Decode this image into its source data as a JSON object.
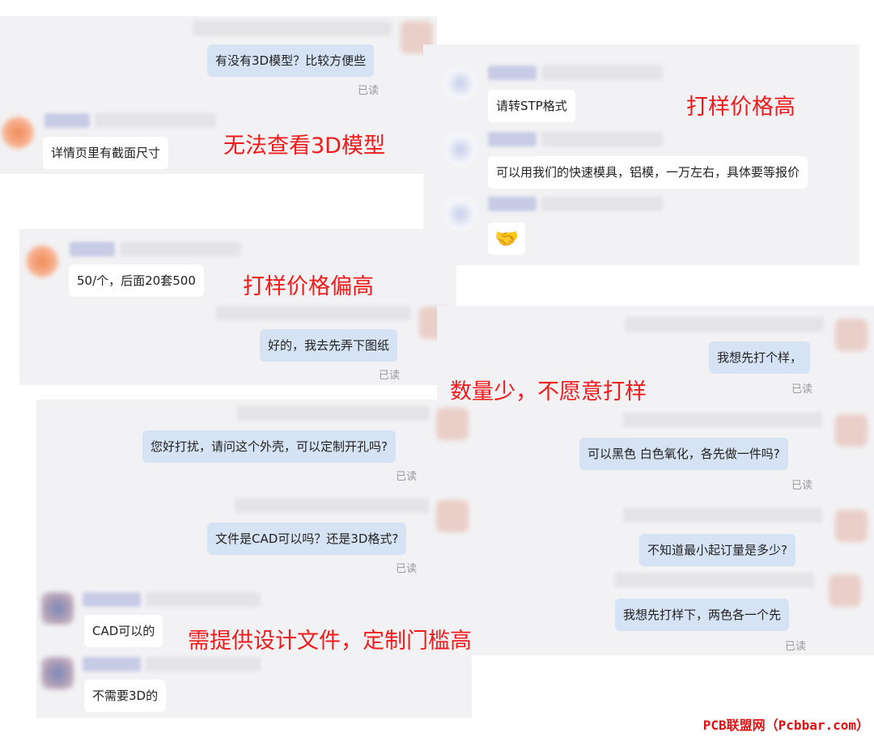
{
  "panel1": {
    "msg_out": "有没有3D模型？比较方便些",
    "read": "已读",
    "msg_in": "详情页里有截面尺寸",
    "annotation": "无法查看3D模型"
  },
  "panel2": {
    "msg1": "请转STP格式",
    "msg2": "可以用我们的快速模具，铝模，一万左右，具体要等报价",
    "emoji": "🤝",
    "emoji_icon": "handshake-icon",
    "annotation": "打样价格高"
  },
  "panel3": {
    "msg_in": "50/个，后面20套500",
    "msg_out": "好的，我去先弄下图纸",
    "read": "已读",
    "annotation": "打样价格偏高"
  },
  "panel4": {
    "msg1": "我想先打个样，",
    "read1": "已读",
    "msg2": "可以黑色 白色氧化，各先做一件吗?",
    "read2": "已读",
    "msg3": "不知道最小起订量是多少?",
    "msg4": "我想先打样下，两色各一个先",
    "read4": "已读",
    "annotation": "数量少，不愿意打样"
  },
  "panel5": {
    "msg1": "您好打扰，请问这个外壳，可以定制开孔吗?",
    "read1": "已读",
    "msg2": "文件是CAD可以吗？还是3D格式?",
    "read2": "已读",
    "msg3": "CAD可以的",
    "msg4": "不需要3D的",
    "annotation": "需提供设计文件，定制门槛高"
  },
  "watermark": "PCB联盟网（Pcbbar.com）",
  "colors": {
    "annotation_red": "#f01c1c",
    "bubble_outgoing": "#d6e3f4",
    "bubble_incoming": "#ffffff",
    "panel_bg": "#f2f2f4"
  }
}
